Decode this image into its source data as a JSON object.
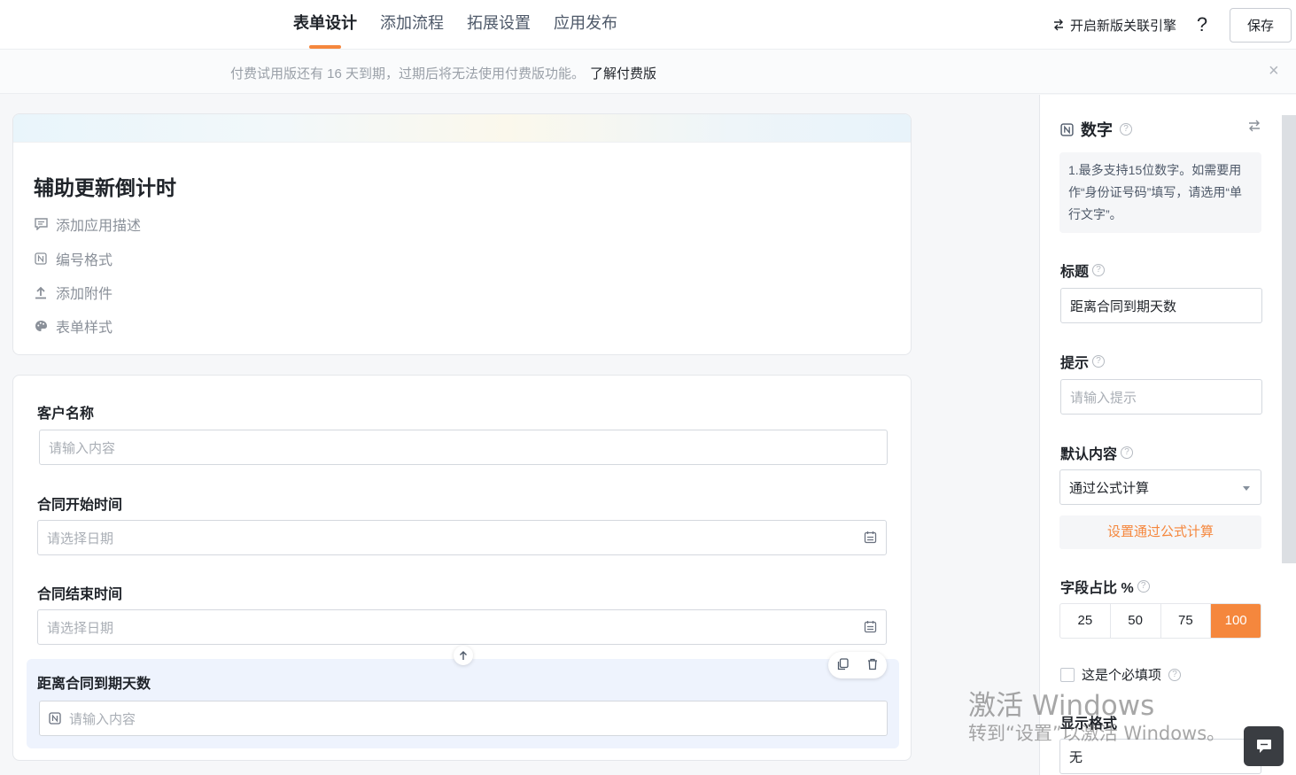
{
  "header": {
    "tabs": [
      {
        "label": "表单设计",
        "active": true
      },
      {
        "label": "添加流程",
        "active": false
      },
      {
        "label": "拓展设置",
        "active": false
      },
      {
        "label": "应用发布",
        "active": false
      }
    ],
    "engine_link": "开启新版关联引擎",
    "help": "?",
    "save_label": "保存"
  },
  "notice": {
    "text": "付费试用版还有 16 天到期，过期后将无法使用付费版功能。",
    "link": "了解付费版",
    "close": "×"
  },
  "app": {
    "title": "辅助更新倒计时",
    "meta_items": [
      {
        "label": "添加应用描述",
        "icon": "comment-icon"
      },
      {
        "label": "编号格式",
        "icon": "number-format-icon"
      },
      {
        "label": "添加附件",
        "icon": "upload-icon"
      },
      {
        "label": "表单样式",
        "icon": "palette-icon"
      }
    ]
  },
  "form": {
    "fields": [
      {
        "label": "客户名称",
        "placeholder": "请输入内容"
      },
      {
        "label": "合同开始时间",
        "placeholder": "请选择日期"
      },
      {
        "label": "合同结束时间",
        "placeholder": "请选择日期"
      },
      {
        "label": "距离合同到期天数",
        "placeholder": "请输入内容"
      }
    ]
  },
  "panel": {
    "type_title": "数字",
    "tip": "1.最多支持15位数字。如需要用作“身份证号码”填写，请选用“单行文字”。",
    "title_label": "标题",
    "title_value": "距离合同到期天数",
    "hint_label": "提示",
    "hint_placeholder": "请输入提示",
    "default_label": "默认内容",
    "default_value": "通过公式计算",
    "formula_button": "设置通过公式计算",
    "ratio_label": "字段占比 %",
    "ratio_options": [
      "25",
      "50",
      "75",
      "100"
    ],
    "ratio_selected": "100",
    "required_label": "这是个必填项",
    "display_format_label": "显示格式",
    "display_format_value": "无"
  },
  "watermark": {
    "line1": "激活 Windows",
    "line2": "转到“设置”以激活 Windows。"
  },
  "colors": {
    "accent": "#f5873d",
    "selected_field_bg": "#eef3fd"
  }
}
